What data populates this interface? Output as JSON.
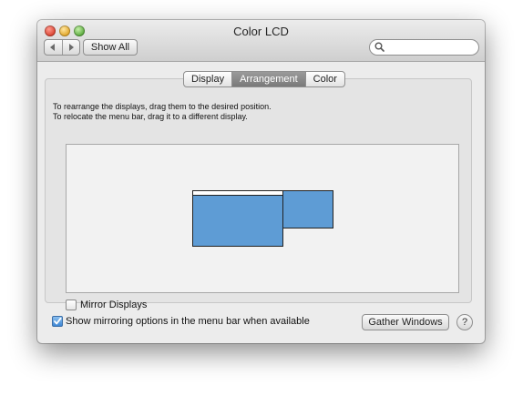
{
  "window": {
    "title": "Color LCD"
  },
  "toolbar": {
    "back_icon": "chevron-left-icon",
    "forward_icon": "chevron-right-icon",
    "show_all_label": "Show All",
    "search_placeholder": "",
    "search_value": ""
  },
  "tabs": [
    {
      "label": "Display",
      "selected": false
    },
    {
      "label": "Arrangement",
      "selected": true
    },
    {
      "label": "Color",
      "selected": false
    }
  ],
  "arrangement": {
    "instruction_1": "To rearrange the displays, drag them to the desired position.",
    "instruction_2": "To relocate the menu bar, drag it to a different display.",
    "display_color": "#5e9cd5"
  },
  "mirror_displays": {
    "label": "Mirror Displays",
    "checked": false
  },
  "footer": {
    "show_mirroring_label": "Show mirroring options in the menu bar when available",
    "show_mirroring_checked": true,
    "gather_windows_label": "Gather Windows",
    "help_label": "?"
  }
}
